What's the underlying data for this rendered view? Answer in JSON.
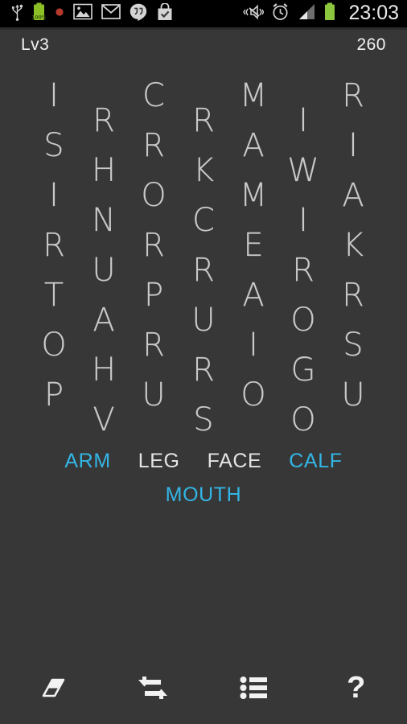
{
  "status_bar": {
    "time": "23:03",
    "battery_text": "100%",
    "icons": [
      {
        "name": "usb-icon"
      },
      {
        "name": "battery-charge-icon"
      },
      {
        "name": "recording-dot-icon"
      },
      {
        "name": "gallery-icon"
      },
      {
        "name": "gmail-icon"
      },
      {
        "name": "hangouts-icon"
      },
      {
        "name": "play-store-icon"
      }
    ],
    "right_icons": [
      {
        "name": "mute-vibrate-icon"
      },
      {
        "name": "alarm-clock-icon"
      },
      {
        "name": "signal-bars-icon"
      },
      {
        "name": "battery-icon"
      }
    ]
  },
  "header": {
    "level": "Lv3",
    "score": "260"
  },
  "grid": {
    "columns": [
      {
        "offset": false,
        "letters": [
          "I",
          "S",
          "I",
          "R",
          "T",
          "O",
          "P"
        ]
      },
      {
        "offset": true,
        "letters": [
          "R",
          "H",
          "N",
          "U",
          "A",
          "H",
          "V"
        ]
      },
      {
        "offset": false,
        "letters": [
          "C",
          "R",
          "O",
          "R",
          "P",
          "R",
          "U"
        ]
      },
      {
        "offset": true,
        "letters": [
          "R",
          "K",
          "C",
          "R",
          "U",
          "R",
          "S"
        ]
      },
      {
        "offset": false,
        "letters": [
          "M",
          "A",
          "M",
          "E",
          "A",
          "I",
          "O"
        ]
      },
      {
        "offset": true,
        "letters": [
          "I",
          "W",
          "I",
          "R",
          "O",
          "G",
          "O"
        ]
      },
      {
        "offset": false,
        "letters": [
          "R",
          "I",
          "A",
          "K",
          "R",
          "S",
          "U"
        ]
      }
    ]
  },
  "words": {
    "row1": [
      {
        "text": "ARM",
        "found": true
      },
      {
        "text": "LEG",
        "found": false
      },
      {
        "text": "FACE",
        "found": false
      },
      {
        "text": "CALF",
        "found": true
      }
    ],
    "row2": [
      {
        "text": "MOUTH",
        "found": true
      }
    ]
  },
  "toolbar": {
    "buttons": [
      {
        "name": "eraser-button",
        "icon": "eraser-icon"
      },
      {
        "name": "shuffle-button",
        "icon": "shuffle-icon"
      },
      {
        "name": "wordlist-button",
        "icon": "list-icon"
      },
      {
        "name": "help-button",
        "icon": "question-mark-icon",
        "glyph": "?"
      }
    ]
  },
  "colors": {
    "background": "#373737",
    "found_word": "#33b5e5",
    "pending_word": "#e4e4e4",
    "letter": "#d6d6d6",
    "statusbar": "#000000"
  }
}
